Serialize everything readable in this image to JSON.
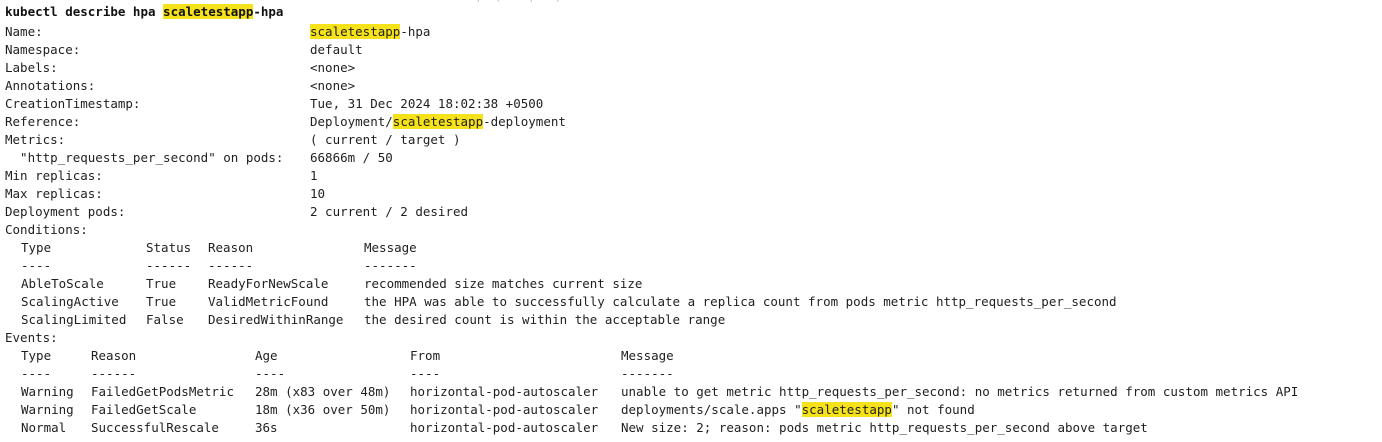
{
  "command": {
    "prefix": "kubectl describe hpa ",
    "highlight": "scaletestapp",
    "suffix": "-hpa"
  },
  "fields": {
    "name": {
      "label": "Name:",
      "hl": "scaletestapp",
      "suffix": "-hpa"
    },
    "namespace": {
      "label": "Namespace:",
      "value": "default"
    },
    "labels": {
      "label": "Labels:",
      "value": "<none>"
    },
    "annotations": {
      "label": "Annotations:",
      "value": "<none>"
    },
    "creation": {
      "label": "CreationTimestamp:",
      "value": "Tue, 31 Dec 2024 18:02:38 +0500"
    },
    "reference": {
      "label": "Reference:",
      "prefix": "Deployment/",
      "hl": "scaletestapp",
      "suffix": "-deployment"
    },
    "metrics": {
      "label": "Metrics:",
      "value": "( current / target )"
    },
    "metric_row": {
      "label": "  \"http_requests_per_second\" on pods:",
      "value": "66866m / 50"
    },
    "min": {
      "label": "Min replicas:",
      "value": "1"
    },
    "max": {
      "label": "Max replicas:",
      "value": "10"
    },
    "pods": {
      "label": "Deployment pods:",
      "value": "2 current / 2 desired"
    }
  },
  "conditions": {
    "title": "Conditions:",
    "headers": [
      "Type",
      "Status",
      "Reason",
      "Message"
    ],
    "dashes": [
      "----",
      "------",
      "------",
      "-------"
    ],
    "rows": [
      [
        "AbleToScale",
        "True",
        "ReadyForNewScale",
        "recommended size matches current size"
      ],
      [
        "ScalingActive",
        "True",
        "ValidMetricFound",
        "the HPA was able to successfully calculate a replica count from pods metric http_requests_per_second"
      ],
      [
        "ScalingLimited",
        "False",
        "DesiredWithinRange",
        "the desired count is within the acceptable range"
      ]
    ]
  },
  "events": {
    "title": "Events:",
    "headers": [
      "Type",
      "Reason",
      "Age",
      "From",
      "Message"
    ],
    "dashes": [
      "----",
      "------",
      "----",
      "----",
      "-------"
    ],
    "rows": [
      {
        "type": "Warning",
        "reason": "FailedGetPodsMetric",
        "age": "28m (x83 over 48m)",
        "from": "horizontal-pod-autoscaler",
        "message": "unable to get metric http_requests_per_second: no metrics returned from custom metrics API"
      },
      {
        "type": "Warning",
        "reason": "FailedGetScale",
        "age": "18m (x36 over 50m)",
        "from": "horizontal-pod-autoscaler",
        "msg_prefix": "deployments/scale.apps \"",
        "msg_hl": "scaletestapp",
        "msg_suffix": "\" not found"
      },
      {
        "type": "Normal",
        "reason": "SuccessfulRescale",
        "age": "36s",
        "from": "horizontal-pod-autoscaler",
        "message": "New size: 2; reason: pods metric http_requests_per_second above target"
      }
    ]
  },
  "colors": {
    "highlight": "#f6e21a",
    "text": "#1f1f1f",
    "background": "#ffffff"
  }
}
